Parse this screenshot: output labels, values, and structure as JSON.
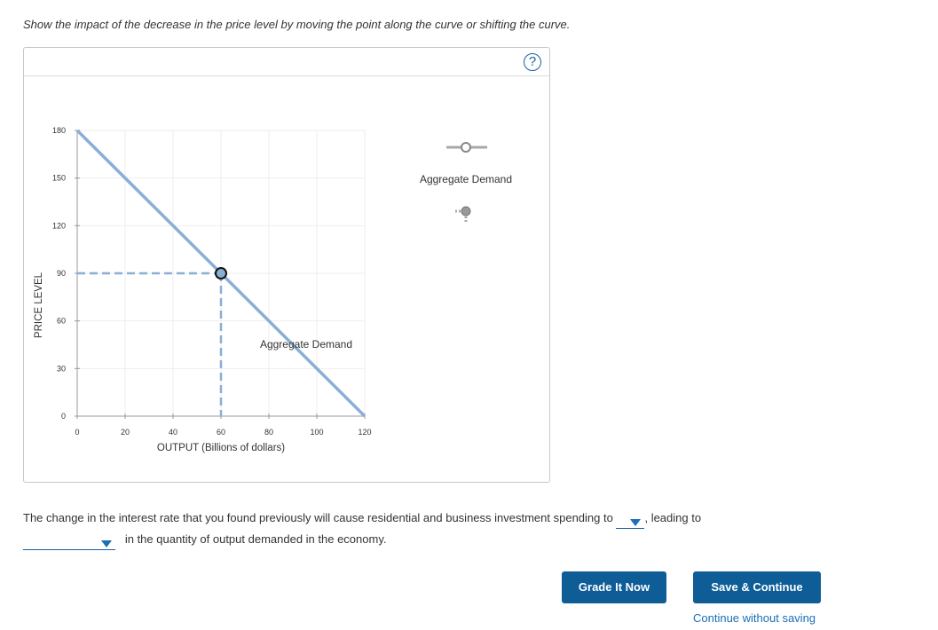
{
  "instruction": "Show the impact of the decrease in the price level by moving the point along the curve or shifting the curve.",
  "help": {
    "label": "?"
  },
  "chart_data": {
    "type": "line",
    "xlabel": "OUTPUT (Billions of dollars)",
    "ylabel": "PRICE LEVEL",
    "xlim": [
      0,
      120
    ],
    "ylim": [
      0,
      180
    ],
    "x_ticks": [
      "0",
      "20",
      "40",
      "60",
      "80",
      "100",
      "120"
    ],
    "y_ticks": [
      "0",
      "30",
      "60",
      "90",
      "120",
      "150",
      "180"
    ],
    "series": [
      {
        "name": "Aggregate Demand",
        "x": [
          0,
          120
        ],
        "y": [
          180,
          0
        ],
        "color": "#8aaed6"
      }
    ],
    "point": {
      "x": 60,
      "y": 90
    },
    "curve_label": "Aggregate Demand",
    "grid": true
  },
  "palette": {
    "tool_label": "Aggregate Demand"
  },
  "question": {
    "part1": "The change in the interest rate that you found previously will cause residential and business investment spending to",
    "part2": ", leading to",
    "part3": "in the quantity of output demanded in the economy.",
    "dropdown1_value": "",
    "dropdown2_value": ""
  },
  "buttons": {
    "grade": "Grade It Now",
    "save": "Save & Continue",
    "continue_link": "Continue without saving"
  }
}
